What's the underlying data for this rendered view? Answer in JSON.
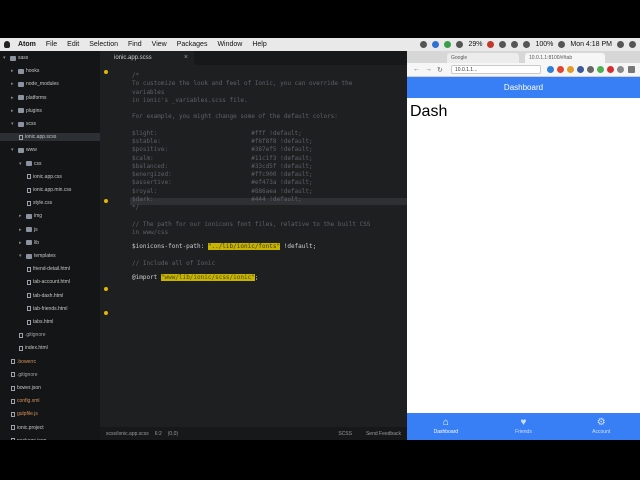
{
  "menubar": {
    "app": "Atom",
    "items": [
      "File",
      "Edit",
      "Selection",
      "Find",
      "View",
      "Packages",
      "Window",
      "Help"
    ],
    "battery_small": "29%",
    "battery": "100%",
    "clock": "Mon 4:18 PM"
  },
  "tree": {
    "nodes": [
      {
        "label": "sass",
        "kind": "folder",
        "open": true
      },
      {
        "label": "hooks",
        "kind": "folder",
        "open": false
      },
      {
        "label": "node_modules",
        "kind": "folder",
        "open": false
      },
      {
        "label": "platforms",
        "kind": "folder",
        "open": false
      },
      {
        "label": "plugins",
        "kind": "folder",
        "open": false
      },
      {
        "label": "scss",
        "kind": "folder",
        "open": true
      },
      {
        "label": "ionic.app.scss",
        "kind": "file",
        "selected": true
      },
      {
        "label": "www",
        "kind": "folder",
        "open": true
      },
      {
        "label": "css",
        "kind": "folder",
        "open": true
      },
      {
        "label": "ionic.app.css",
        "kind": "file"
      },
      {
        "label": "ionic.app.min.css",
        "kind": "file"
      },
      {
        "label": "style.css",
        "kind": "file"
      },
      {
        "label": "img",
        "kind": "folder",
        "open": false
      },
      {
        "label": "js",
        "kind": "folder",
        "open": false
      },
      {
        "label": "lib",
        "kind": "folder",
        "open": false
      },
      {
        "label": "templates",
        "kind": "folder",
        "open": true
      },
      {
        "label": "friend-detail.html",
        "kind": "file"
      },
      {
        "label": "tab-account.html",
        "kind": "file"
      },
      {
        "label": "tab-dash.html",
        "kind": "file"
      },
      {
        "label": "tab-friends.html",
        "kind": "file"
      },
      {
        "label": "tabs.html",
        "kind": "file"
      },
      {
        "label": ".gitignore",
        "kind": "file",
        "dim": true
      },
      {
        "label": "index.html",
        "kind": "file"
      },
      {
        "label": ".bowerrc",
        "kind": "file",
        "orange": true
      },
      {
        "label": ".gitignore",
        "kind": "file",
        "dim": true
      },
      {
        "label": "bower.json",
        "kind": "file"
      },
      {
        "label": "config.xml",
        "kind": "file",
        "orange": true
      },
      {
        "label": "gulpfile.js",
        "kind": "file",
        "orange": true
      },
      {
        "label": "ionic.project",
        "kind": "file"
      },
      {
        "label": "package.json",
        "kind": "file"
      }
    ]
  },
  "editor": {
    "tab": "ionic.app.scss",
    "lines": [
      {
        "text": "/*",
        "kind": "comment"
      },
      {
        "text": "To customize the look and feel of Ionic, you can override the",
        "kind": "comment"
      },
      {
        "text": "variables",
        "kind": "comment"
      },
      {
        "text": "in ionic's _variables.scss file.",
        "kind": "comment"
      },
      {
        "text": "",
        "kind": "comment"
      },
      {
        "text": "For example, you might change some of the default colors:",
        "kind": "comment"
      },
      {
        "text": "",
        "kind": "comment"
      },
      {
        "text": "$light:                          #fff !default;",
        "kind": "comment"
      },
      {
        "text": "$stable:                         #f8f8f8 !default;",
        "kind": "comment"
      },
      {
        "text": "$positive:                       #387ef5 !default;",
        "kind": "comment"
      },
      {
        "text": "$calm:                           #11c1f3 !default;",
        "kind": "comment"
      },
      {
        "text": "$balanced:                       #33cd5f !default;",
        "kind": "comment"
      },
      {
        "text": "$energized:                      #ffc900 !default;",
        "kind": "comment"
      },
      {
        "text": "$assertive:                      #ef473a !default;",
        "kind": "comment"
      },
      {
        "text": "$royal:                          #886aea !default;",
        "kind": "comment"
      },
      {
        "text": "$dark:                           #444 !default;",
        "kind": "comment"
      },
      {
        "text": "*/",
        "kind": "comment"
      },
      {
        "text": "",
        "kind": "comment"
      },
      {
        "text": "// The path for our ionicons font files, relative to the built CSS",
        "kind": "comment"
      },
      {
        "text": "in www/css",
        "kind": "comment"
      },
      {
        "text": "$ionicons-font-path: ",
        "kind": "var",
        "highlight": "\"../lib/ionic/fonts\"",
        "tail": " !default;"
      },
      {
        "text": "",
        "kind": "comment"
      },
      {
        "text": "// Include all of Ionic",
        "kind": "comment"
      },
      {
        "text": "@import ",
        "kind": "var",
        "highlight2": "\"www/lib/ionic/scss/ionic\"",
        "tail": ";"
      }
    ],
    "status": {
      "path": "scss/ionic.app.scss",
      "cursor": "6:2",
      "selection": "(0,0)",
      "grammar": "SCSS",
      "feedback": "Send Feedback"
    }
  },
  "browser": {
    "tab1": "Google",
    "tab2": "10.0.1.1:8100/#/tab",
    "url": "10.0.1.1...",
    "header": "Dashboard",
    "page_title": "Dash",
    "tabs": [
      {
        "label": "Dashboard",
        "icon": "home-icon",
        "glyph": "⌂",
        "active": true
      },
      {
        "label": "Friends",
        "icon": "heart-icon",
        "glyph": "♥",
        "active": false
      },
      {
        "label": "Account",
        "icon": "gear-icon",
        "glyph": "⚙",
        "active": false
      }
    ],
    "accent": "#387ef5"
  }
}
